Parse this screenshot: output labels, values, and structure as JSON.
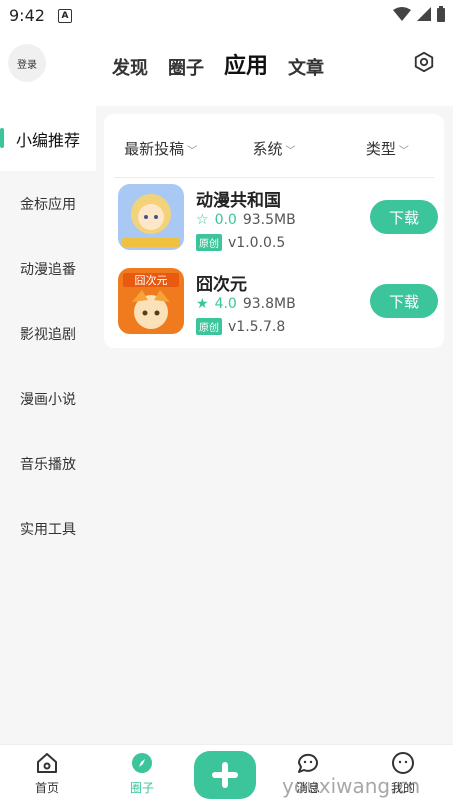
{
  "status_bar": {
    "time": "9:42",
    "notif_icon": "A"
  },
  "header": {
    "login_label": "登录",
    "tabs": [
      {
        "label": "发现"
      },
      {
        "label": "圈子"
      },
      {
        "label": "应用"
      },
      {
        "label": "文章"
      }
    ],
    "active_tab": "应用"
  },
  "sidebar": {
    "items": [
      {
        "label": "小编推荐"
      },
      {
        "label": "金标应用"
      },
      {
        "label": "动漫追番"
      },
      {
        "label": "影视追剧"
      },
      {
        "label": "漫画小说"
      },
      {
        "label": "音乐播放"
      },
      {
        "label": "实用工具"
      }
    ]
  },
  "filters": [
    {
      "label": "最新投稿"
    },
    {
      "label": "系统"
    },
    {
      "label": "类型"
    }
  ],
  "apps": [
    {
      "name": "动漫共和国",
      "rating": "0.0",
      "size": "93.5MB",
      "badge": "原创",
      "version": "v1.0.0.5",
      "download_label": "下载",
      "icon_colors": [
        "#a9c9f4",
        "#f3d37a"
      ]
    },
    {
      "name": "囧次元",
      "rating": "4.0",
      "size": "93.8MB",
      "badge": "原创",
      "version": "v1.5.7.8",
      "download_label": "下载",
      "icon_colors": [
        "#f07a1e",
        "#fbe1b8"
      ]
    }
  ],
  "icon_text": {
    "app2": "囧次元",
    "app1": "动漫共和国"
  },
  "bottom_nav": {
    "items": [
      {
        "label": "首页"
      },
      {
        "label": "圈子"
      },
      {
        "label": "消息"
      },
      {
        "label": "我的"
      }
    ]
  },
  "accent_color": "#3cc49b",
  "watermark": "youxiwang.cn"
}
